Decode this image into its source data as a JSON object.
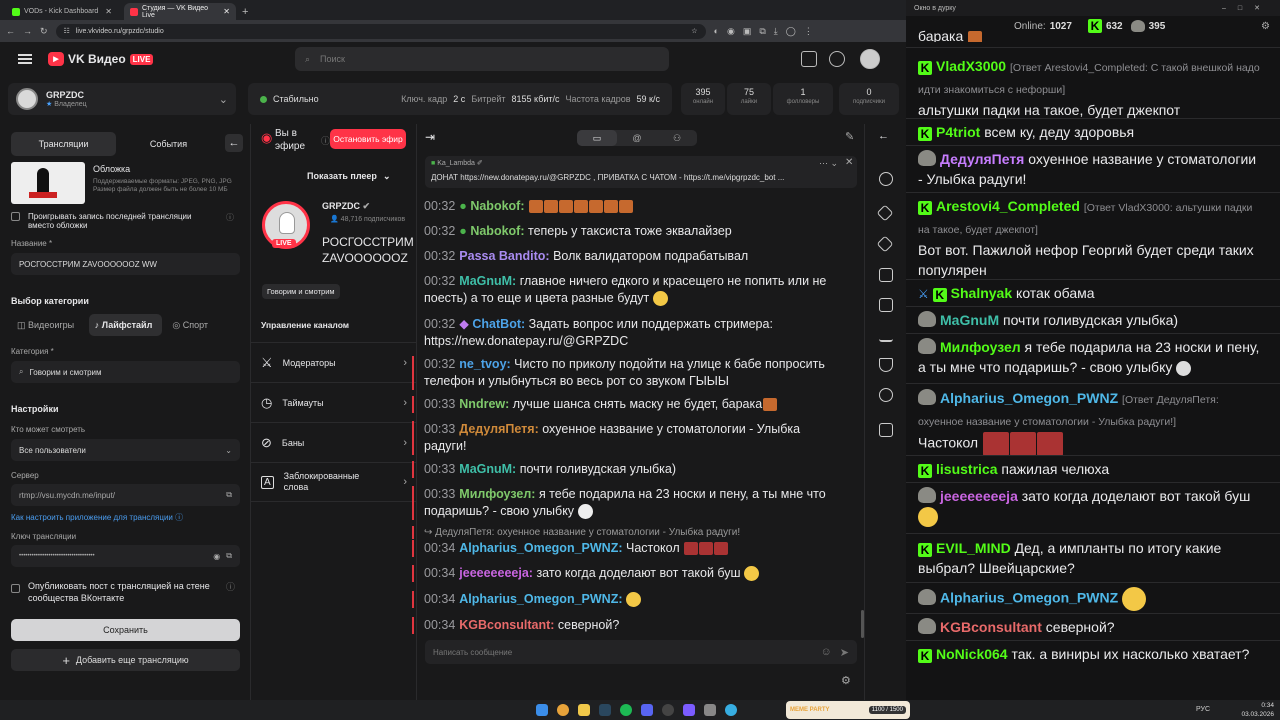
{
  "browser": {
    "tabs": [
      {
        "label": "VODs - Kick Dashboard",
        "color": "#53fc18"
      },
      {
        "label": "Студия — VK Видео Live",
        "color": "#ff3347"
      }
    ],
    "url": "live.vkvideo.ru/grpzdc/studio"
  },
  "vk": {
    "logo": "VK Видео",
    "live": "LIVE",
    "search_placeholder": "Поиск",
    "account": {
      "name": "GRPZDC",
      "role": "Владелец"
    },
    "status": {
      "label": "Стабильно",
      "keyframe_label": "Ключ. кадр",
      "keyframe": "2 с",
      "bitrate_label": "Битрейт",
      "bitrate": "8155 кбит/с",
      "fps_label": "Частота кадров",
      "fps": "59 к/с"
    },
    "stats": [
      {
        "value": "395",
        "label": "онлайн"
      },
      {
        "value": "75",
        "label": "лайки"
      },
      {
        "value": "1",
        "label": "фолловеры"
      },
      {
        "value": "0",
        "label": "подписчики"
      }
    ]
  },
  "left": {
    "tab_streams": "Трансляции",
    "tab_events": "События",
    "cover_title": "Обложка",
    "cover_desc": "Поддерживаемые форматы: JPEG, PNG, JPG Размер файла должен быть не более 10 МБ",
    "play_last": "Проигрывать запись последней трансляции вместо обложки",
    "name_label": "Название *",
    "name_value": "РОСГОССТРИМ ZAVOOOOOOZ WW",
    "category_choice": "Выбор категории",
    "cat_games": "Видеоигры",
    "cat_lifestyle": "Лайфстайл",
    "cat_sport": "Спорт",
    "category_label": "Категория *",
    "category_value": "Говорим и смотрим",
    "settings": "Настройки",
    "who_label": "Кто может смотреть",
    "who_value": "Все пользователи",
    "server_label": "Сервер",
    "server_value": "rtmp://vsu.mycdn.me/input/",
    "howto": "Как настроить приложение для трансляции",
    "key_label": "Ключ трансляции",
    "key_value": "••••••••••••••••••••••••••••••••••••",
    "publish": "Опубликовать пост с трансляцией на стене сообщества ВКонтакте",
    "save": "Сохранить",
    "add": "Добавить еще трансляцию"
  },
  "mid": {
    "on_air": "Вы в эфире",
    "stop": "Остановить эфир",
    "show_player": "Показать плеер",
    "channel": "GRPZDC",
    "subs": "48,716 подписчиков",
    "title": "РОСГОССТРИМ ZAVOOOOOOZ WW",
    "live": "LIVE",
    "tag": "Говорим и смотрим",
    "manage": "Управление каналом",
    "menu": [
      "Модераторы",
      "Таймауты",
      "Баны",
      "Заблокированные слова"
    ]
  },
  "chat": {
    "pinned_user": "Ka_Lambda",
    "pinned_text": "ДОНАТ https://new.donatepay.ru/@GRPZDC , ПРИВАТКА С ЧАТОМ - https://t.me/vipgrpzdc_bot ...",
    "input_placeholder": "Написать сообщение",
    "reply_preview": "ДедуляПетя: охуенное название у стоматологии - Улыбка радуги!",
    "messages": [
      {
        "time": "00:32",
        "user": "Nabokof:",
        "color": "#7fc96b",
        "text": ""
      },
      {
        "time": "00:32",
        "user": "Nabokof:",
        "color": "#7fc96b",
        "text": "теперь у таксиста тоже эквалайзер"
      },
      {
        "time": "00:32",
        "user": "Passa Bandito:",
        "color": "#a98bf0",
        "text": "Волк валидатором подрабатывал"
      },
      {
        "time": "00:32",
        "user": "MaGnuM:",
        "color": "#3fbfa8",
        "text": "главное ничего едкого и красещего не попить или не поесть) а то еще и цвета разные будут"
      },
      {
        "time": "00:32",
        "user": "ChatBot:",
        "color": "#c07cf0",
        "text": "Задать вопрос или поддержать стримера: https://new.donatepay.ru/@GRPZDC"
      },
      {
        "time": "00:32",
        "user": "ne_tvoy:",
        "color": "#4da3e8",
        "text": "Чисто по приколу подойти на улице к бабе попросить телефон и улыбнуться во весь рот со звуком ГЫЫЫ"
      },
      {
        "time": "00:33",
        "user": "Nndrew:",
        "color": "#7fc96b",
        "text": "лучше шанса снять маску не будет, барака"
      },
      {
        "time": "00:33",
        "user": "ДедуляПетя:",
        "color": "#d08a3a",
        "text": "охуенное название у стоматологии - Улыбка радуги!"
      },
      {
        "time": "00:33",
        "user": "MaGnuM:",
        "color": "#3fbfa8",
        "text": "почти голивудская улыбка)"
      },
      {
        "time": "00:33",
        "user": "Милфоузел:",
        "color": "#7fc96b",
        "text": "я тебе подарила на 23 носки и пену, а ты мне что подаришь? - свою улыбку"
      },
      {
        "time": "00:34",
        "user": "Alpharius_Omegon_PWNZ:",
        "color": "#4fb8e8",
        "text": "Частокол"
      },
      {
        "time": "00:34",
        "user": "jeeeeeeeeja:",
        "color": "#c865e0",
        "text": "зато когда доделают вот такой буш"
      },
      {
        "time": "00:34",
        "user": "Alpharius_Omegon_PWNZ:",
        "color": "#4fb8e8",
        "text": ""
      },
      {
        "time": "00:34",
        "user": "KGBconsultant:",
        "color": "#e86a6a",
        "text": "северной?"
      }
    ]
  },
  "popout": {
    "title": "Окно в дурку",
    "online_label": "Online:",
    "online": "1027",
    "kick_count": "632",
    "vk_count": "395",
    "top_text": "барака",
    "messages": [
      {
        "user": "VladX3000",
        "badge": "kick",
        "color": "#53fc18",
        "reply": "[Ответ Arestovi4_Completed: С такой внешкой надо идти знакомиться с нефорши]",
        "text": "альтушки падки на такое, будет джекпот"
      },
      {
        "user": "P4triot",
        "badge": "kick",
        "color": "#53fc18",
        "reply": "",
        "text": "всем ку, деду здоровья"
      },
      {
        "user": "ДедуляПетя",
        "badge": "vk",
        "color": "#c77dff",
        "reply": "",
        "text": "охуенное название у стоматологии - Улыбка радуги!"
      },
      {
        "user": "Arestovi4_Completed",
        "badge": "kick",
        "color": "#53fc18",
        "reply": "[Ответ VladX3000: альтушки падки на такое, будет джекпот]",
        "text": "Вот вот. Пажилой нефор Георгий будет среди таких популярен"
      },
      {
        "user": "Shalnyak",
        "badge": "kick",
        "color": "#53fc18",
        "reply": "",
        "text": "котак обама"
      },
      {
        "user": "MaGnuM",
        "badge": "vk",
        "color": "#3fbfa8",
        "reply": "",
        "text": "почти голивудская улыбка)"
      },
      {
        "user": "Милфоузел",
        "badge": "vk",
        "color": "#53fc18",
        "reply": "",
        "text": "я тебе подарила на 23 носки и пену, а ты мне что подаришь? - свою улыбку"
      },
      {
        "user": "Alpharius_Omegon_PWNZ",
        "badge": "vk",
        "color": "#4fb8e8",
        "reply": "[Ответ ДедуляПетя: охуенное название у стоматологии - Улыбка радуги!]",
        "text": "Частокол"
      },
      {
        "user": "lisustrica",
        "badge": "kick",
        "color": "#53fc18",
        "reply": "",
        "text": "пажилая челюха"
      },
      {
        "user": "jeeeeeeeeja",
        "badge": "vk",
        "color": "#c865e0",
        "reply": "",
        "text": "зато когда доделают вот такой буш"
      },
      {
        "user": "EVIL_MIND",
        "badge": "kick",
        "color": "#53fc18",
        "reply": "",
        "text": "Дед, а импланты по итогу какие выбрал? Швейцарские?"
      },
      {
        "user": "Alpharius_Omegon_PWNZ",
        "badge": "vk",
        "color": "#4fb8e8",
        "reply": "",
        "text": ""
      },
      {
        "user": "KGBconsultant",
        "badge": "vk",
        "color": "#e86a6a",
        "reply": "",
        "text": "северной?"
      },
      {
        "user": "NoNick064",
        "badge": "kick",
        "color": "#53fc18",
        "reply": "",
        "text": "так. а виниры их насколько хватает?"
      }
    ]
  },
  "taskbar": {
    "lang": "РУС",
    "time": "0:34",
    "date": "03.03.2026",
    "meme": "MEME PARTY",
    "meme_count": "1100 / 1500"
  }
}
